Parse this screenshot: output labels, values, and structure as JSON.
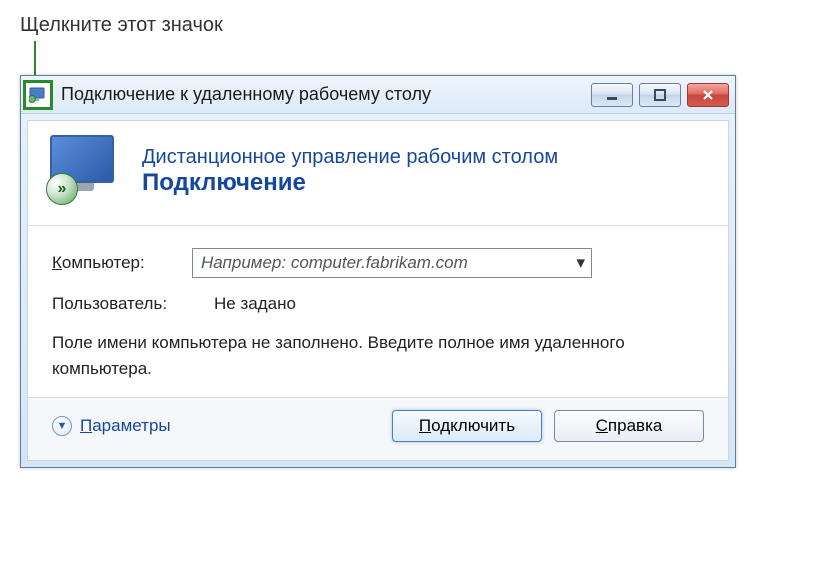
{
  "callout": "Щелкните этот значок",
  "window": {
    "title": "Подключение к удаленному рабочему столу"
  },
  "header": {
    "line1": "Дистанционное управление рабочим столом",
    "line2": "Подключение"
  },
  "form": {
    "computer_label_pre": "К",
    "computer_label_rest": "омпьютер:",
    "computer_placeholder": "Например: computer.fabrikam.com",
    "user_label": "Пользователь:",
    "user_value": "Не задано",
    "hint": "Поле имени компьютера не заполнено. Введите полное имя удаленного компьютера."
  },
  "footer": {
    "options_pre": "П",
    "options_rest": "араметры",
    "connect_pre": "П",
    "connect_rest": "одключить",
    "help_pre": "С",
    "help_rest": "правка"
  },
  "icons": {
    "badge": "»"
  }
}
